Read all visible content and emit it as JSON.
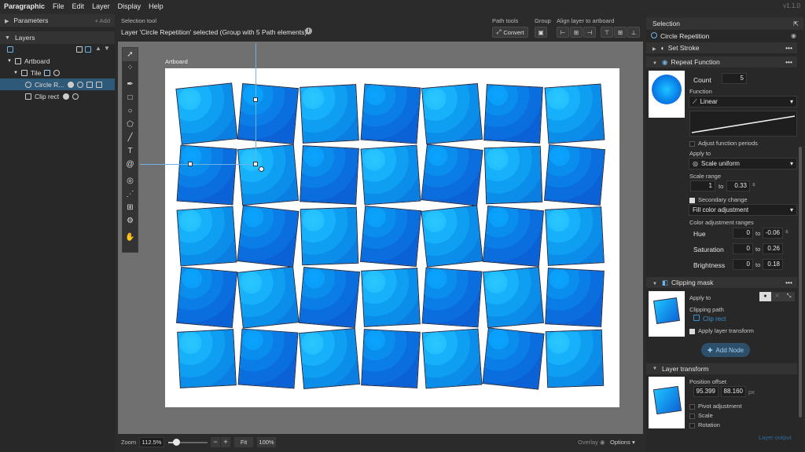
{
  "app": {
    "name": "Paragraphic",
    "version": "v1.1.0",
    "menus": [
      "File",
      "Edit",
      "Layer",
      "Display",
      "Help"
    ]
  },
  "left_panel": {
    "parameters_title": "Parameters",
    "add_label": "+ Add",
    "layers_title": "Layers",
    "tree": [
      {
        "label": "Artboard",
        "depth": 0
      },
      {
        "label": "Tile",
        "depth": 1
      },
      {
        "label": "Circle R...",
        "depth": 2,
        "selected": true
      },
      {
        "label": "Clip rect",
        "depth": 2
      }
    ]
  },
  "topbar": {
    "tool_name": "Selection tool",
    "status_message": "Layer 'Circle Repetition' selected (Group with 5 Path elements)",
    "path_tools_label": "Path tools",
    "convert_label": "Convert",
    "group_label": "Group",
    "align_label": "Align layer to artboard"
  },
  "canvas": {
    "artboard_label": "Artboard",
    "rows": 5,
    "cols": 7
  },
  "statusbar": {
    "zoom_label": "Zoom",
    "zoom_value": "112.5%",
    "zoom_slider_fraction": 0.2,
    "minus_label": "−",
    "plus_label": "+",
    "fit_label": "Fit",
    "hundred_label": "100%",
    "overlay_label": "Overlay",
    "options_label": "Options"
  },
  "right_panel": {
    "title": "Selection",
    "layer_name": "Circle Repetition",
    "set_stroke_label": "Set Stroke",
    "repeat_function": {
      "title": "Repeat Function",
      "count_label": "Count",
      "count_value": "5",
      "function_label": "Function",
      "function_value": "Linear",
      "adjust_periods_label": "Adjust function periods",
      "apply_to_label": "Apply to",
      "apply_to_value": "Scale uniform",
      "scale_range_label": "Scale range",
      "scale_from": "1",
      "scale_to": "0.33",
      "to_label": "to",
      "secondary_change_label": "Secondary change",
      "secondary_change_value": "Fill color adjustment",
      "color_ranges_label": "Color adjustment ranges",
      "hue_label": "Hue",
      "hue_from": "0",
      "hue_to": "-0.06",
      "saturation_label": "Saturation",
      "sat_from": "0",
      "sat_to": "0.26",
      "brightness_label": "Brightness",
      "bri_from": "0",
      "bri_to": "0.18"
    },
    "clipping_mask": {
      "title": "Clipping mask",
      "apply_to_label": "Apply to",
      "clipping_path_label": "Clipping path",
      "clipping_path_value": "Clip rect",
      "apply_transform_label": "Apply layer transform"
    },
    "add_node_label": "Add Node",
    "layer_transform": {
      "title": "Layer transform",
      "position_offset_label": "Position offset",
      "pos_x": "95.399",
      "pos_y": "88.160",
      "unit": "px",
      "pivot_label": "Pivot adjustment",
      "scale_label": "Scale",
      "rotation_label": "Rotation"
    },
    "layer_output_label": "Layer output"
  }
}
